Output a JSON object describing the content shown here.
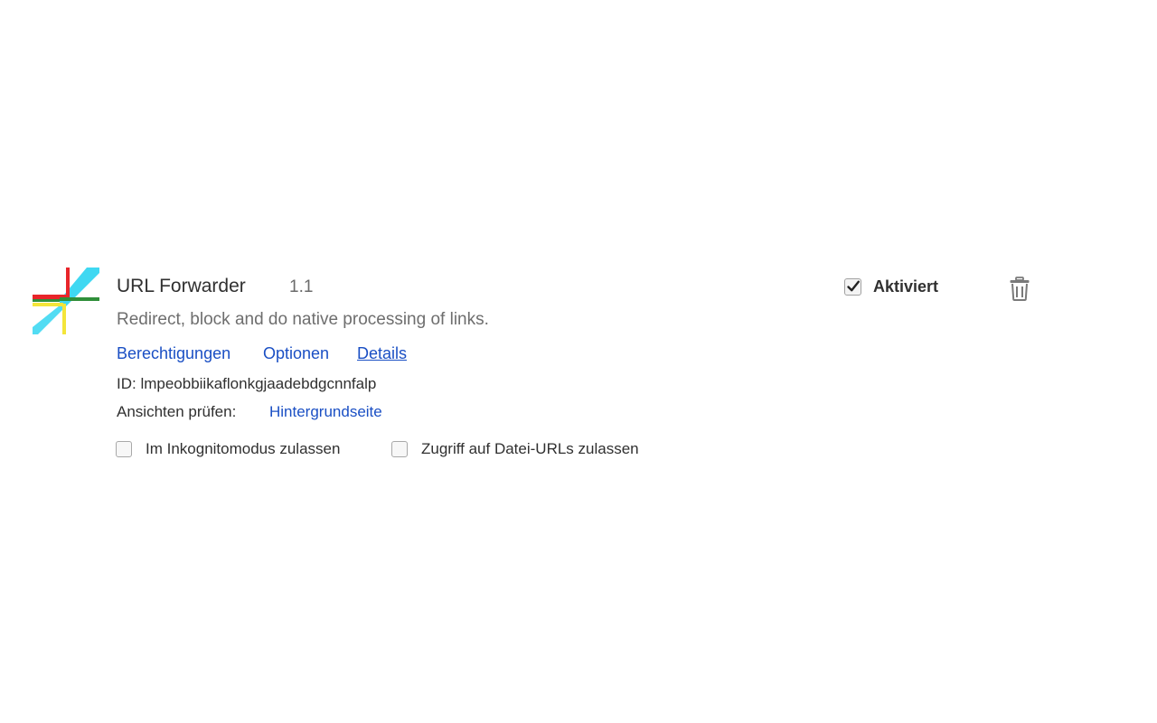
{
  "extension": {
    "name": "URL Forwarder",
    "version": "1.1",
    "description": "Redirect, block and do native processing of links.",
    "links": {
      "permissions": "Berechtigungen",
      "options": "Optionen",
      "details": "Details"
    },
    "id_text": "ID: lmpeobbiikaflonkgjaadebdgcnnfalp",
    "inspect_views": {
      "label": "Ansichten prüfen:",
      "background_page": "Hintergrundseite"
    },
    "options_checkboxes": {
      "incognito": {
        "label": "Im Inkognitomodus zulassen",
        "checked": false
      },
      "file_urls": {
        "label": "Zugriff auf Datei-URLs zulassen",
        "checked": false
      }
    },
    "enabled": {
      "label": "Aktiviert",
      "checked": true
    },
    "icon": "url-forwarder-logo",
    "remove_icon": "trash-icon"
  },
  "colors": {
    "link": "#1a4fc4",
    "text": "#303030",
    "muted": "#6e6e6e",
    "logo_red": "#e8252a",
    "logo_cyan": "#3fd8f2",
    "logo_yellow": "#f4e53a",
    "logo_green": "#2f8f3a"
  }
}
